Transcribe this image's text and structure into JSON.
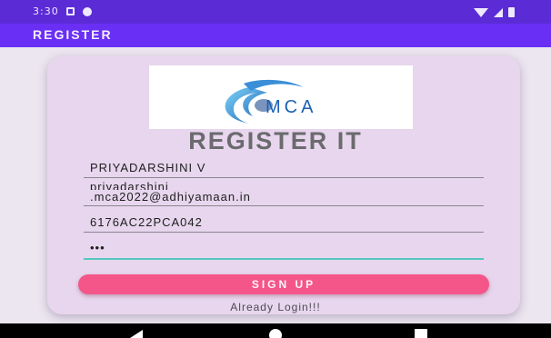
{
  "status_bar": {
    "time": "3:30",
    "icons_left": [
      "notification-square-icon",
      "notification-dot-icon"
    ],
    "icons_right": [
      "wifi-icon",
      "signal-icon",
      "battery-icon"
    ]
  },
  "app_bar": {
    "title": "REGISTER"
  },
  "logo": {
    "text": "MCA"
  },
  "form": {
    "heading": "REGISTER IT",
    "name": "PRIYADARSHINI V",
    "email_line1": "priyadarshini",
    "email_line2": ".mca2022@adhiyamaan.in",
    "register_no": "6176AC22PCA042",
    "password_masked": "•••",
    "signup_label": "SIGN UP",
    "login_link": "Already Login!!!"
  },
  "colors": {
    "status_bar": "#5b2bd6",
    "app_bar": "#6a2ff4",
    "card": "#e7d6ed",
    "button": "#f4568a",
    "focus_underline": "#56c6c0"
  },
  "nav_bar": {
    "icons": [
      "back-icon",
      "home-icon",
      "recents-icon"
    ]
  }
}
